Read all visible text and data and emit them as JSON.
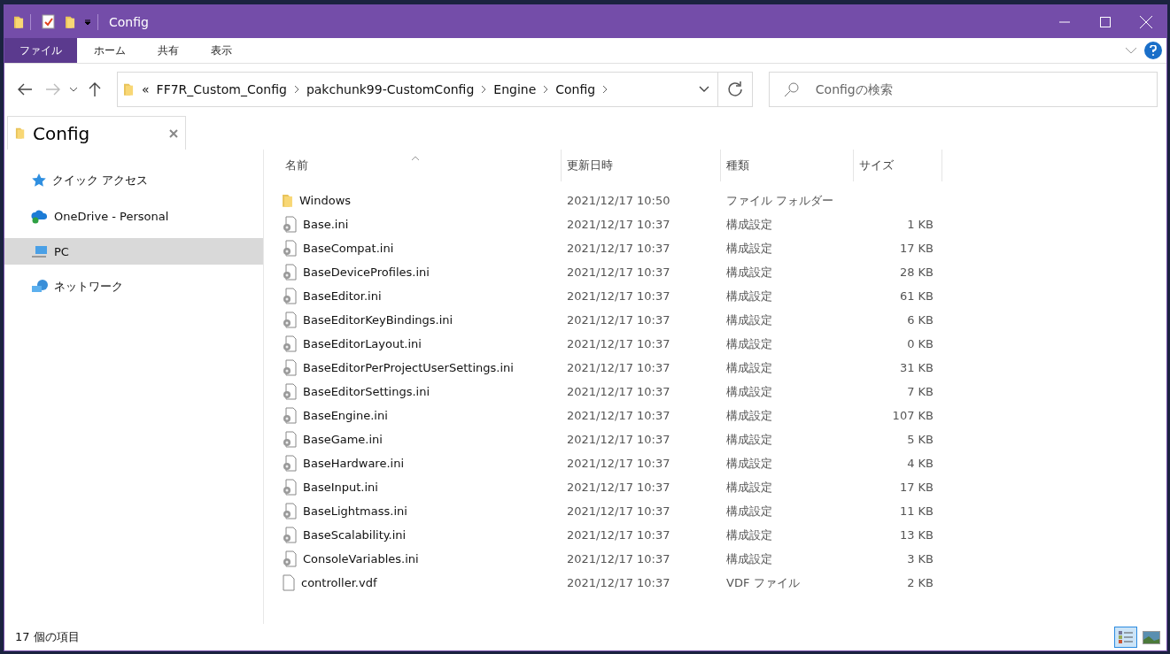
{
  "window": {
    "title": "Config"
  },
  "ribbon_tabs": [
    {
      "label": "ファイル",
      "selected": true
    },
    {
      "label": "ホーム",
      "selected": false
    },
    {
      "label": "共有",
      "selected": false
    },
    {
      "label": "表示",
      "selected": false
    }
  ],
  "address": {
    "overflow": "«",
    "crumbs": [
      "FF7R_Custom_Config",
      "pakchunk99-CustomConfig",
      "Engine",
      "Config"
    ]
  },
  "search": {
    "placeholder": "Configの検索"
  },
  "pane_tab": {
    "title": "Config"
  },
  "sidebar": {
    "items": [
      {
        "label": "クイック アクセス",
        "kind": "quick",
        "selected": false
      },
      {
        "label": "OneDrive - Personal",
        "kind": "cloud",
        "selected": false
      },
      {
        "label": "PC",
        "kind": "pc",
        "selected": true
      },
      {
        "label": "ネットワーク",
        "kind": "network",
        "selected": false
      }
    ]
  },
  "table": {
    "columns": [
      "名前",
      "更新日時",
      "種類",
      "サイズ"
    ],
    "rows": [
      {
        "name": "Windows",
        "date": "2021/12/17 10:50",
        "type": "ファイル フォルダー",
        "kind": "folder"
      },
      {
        "name": "Base.ini",
        "date": "2021/12/17 10:37",
        "type": "構成設定",
        "size": "1 KB",
        "kind": "config"
      },
      {
        "name": "BaseCompat.ini",
        "date": "2021/12/17 10:37",
        "type": "構成設定",
        "size": "17 KB",
        "kind": "config"
      },
      {
        "name": "BaseDeviceProfiles.ini",
        "date": "2021/12/17 10:37",
        "type": "構成設定",
        "size": "28 KB",
        "kind": "config"
      },
      {
        "name": "BaseEditor.ini",
        "date": "2021/12/17 10:37",
        "type": "構成設定",
        "size": "61 KB",
        "kind": "config"
      },
      {
        "name": "BaseEditorKeyBindings.ini",
        "date": "2021/12/17 10:37",
        "type": "構成設定",
        "size": "6 KB",
        "kind": "config"
      },
      {
        "name": "BaseEditorLayout.ini",
        "date": "2021/12/17 10:37",
        "type": "構成設定",
        "size": "0 KB",
        "kind": "config"
      },
      {
        "name": "BaseEditorPerProjectUserSettings.ini",
        "date": "2021/12/17 10:37",
        "type": "構成設定",
        "size": "31 KB",
        "kind": "config"
      },
      {
        "name": "BaseEditorSettings.ini",
        "date": "2021/12/17 10:37",
        "type": "構成設定",
        "size": "7 KB",
        "kind": "config"
      },
      {
        "name": "BaseEngine.ini",
        "date": "2021/12/17 10:37",
        "type": "構成設定",
        "size": "107 KB",
        "kind": "config"
      },
      {
        "name": "BaseGame.ini",
        "date": "2021/12/17 10:37",
        "type": "構成設定",
        "size": "5 KB",
        "kind": "config"
      },
      {
        "name": "BaseHardware.ini",
        "date": "2021/12/17 10:37",
        "type": "構成設定",
        "size": "4 KB",
        "kind": "config"
      },
      {
        "name": "BaseInput.ini",
        "date": "2021/12/17 10:37",
        "type": "構成設定",
        "size": "17 KB",
        "kind": "config"
      },
      {
        "name": "BaseLightmass.ini",
        "date": "2021/12/17 10:37",
        "type": "構成設定",
        "size": "11 KB",
        "kind": "config"
      },
      {
        "name": "BaseScalability.ini",
        "date": "2021/12/17 10:37",
        "type": "構成設定",
        "size": "13 KB",
        "kind": "config"
      },
      {
        "name": "ConsoleVariables.ini",
        "date": "2021/12/17 10:37",
        "type": "構成設定",
        "size": "3 KB",
        "kind": "config"
      },
      {
        "name": "controller.vdf",
        "date": "2021/12/17 10:37",
        "type": "VDF ファイル",
        "size": "2 KB",
        "kind": "file"
      }
    ]
  },
  "status_bar": {
    "text": "17 個の項目"
  },
  "view_buttons": [
    {
      "kind": "details",
      "selected": true
    },
    {
      "kind": "thumbnails",
      "selected": false
    }
  ]
}
